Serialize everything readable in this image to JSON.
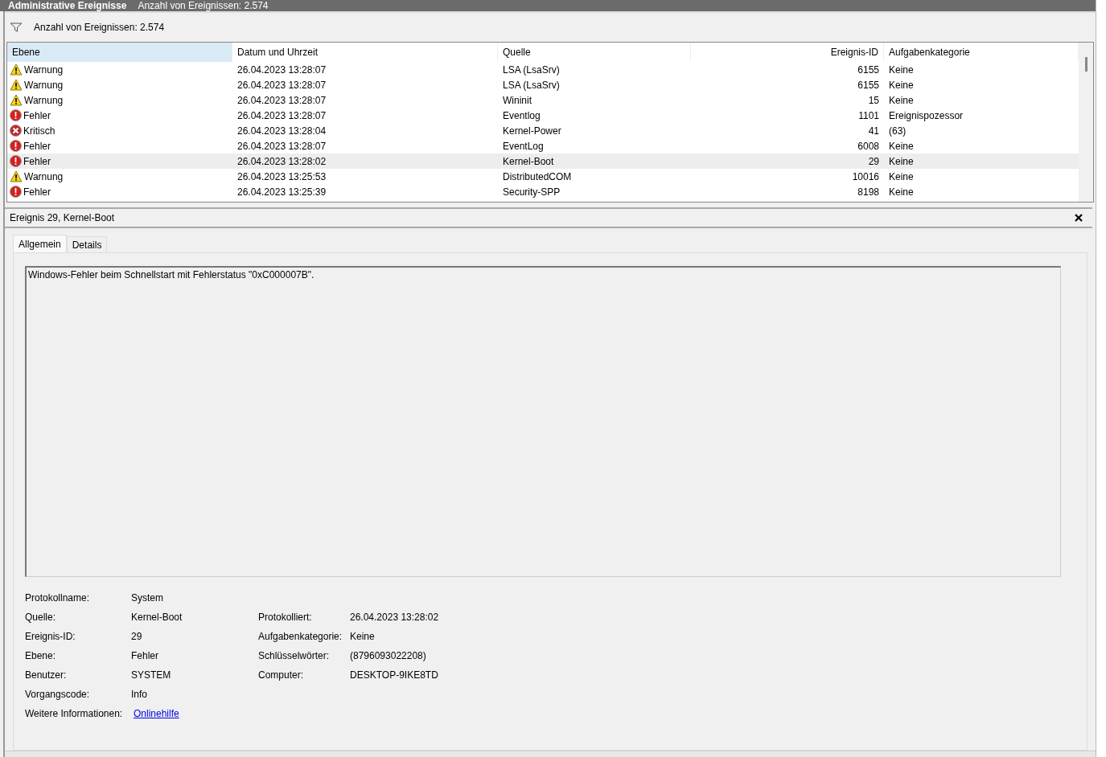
{
  "title_bar": {
    "title": "Administrative Ereignisse",
    "count": "Anzahl von Ereignissen: 2.574"
  },
  "filter_bar": {
    "text": "Anzahl von Ereignissen: 2.574"
  },
  "table": {
    "columns": [
      {
        "label": "Ebene",
        "selected": true
      },
      {
        "label": "Datum und Uhrzeit",
        "selected": false
      },
      {
        "label": "Quelle",
        "selected": false
      },
      {
        "label": "Ereignis-ID",
        "selected": false
      },
      {
        "label": "Aufgabenkategorie",
        "selected": false
      }
    ],
    "rows": [
      {
        "kind": "warning",
        "level_text": "Warnung",
        "date": "26.04.2023 13:28:07",
        "source": "LSA (LsaSrv)",
        "id": "6155",
        "category": "Keine",
        "selected": false
      },
      {
        "kind": "warning",
        "level_text": "Warnung",
        "date": "26.04.2023 13:28:07",
        "source": "LSA (LsaSrv)",
        "id": "6155",
        "category": "Keine",
        "selected": false
      },
      {
        "kind": "warning",
        "level_text": "Warnung",
        "date": "26.04.2023 13:28:07",
        "source": "Wininit",
        "id": "15",
        "category": "Keine",
        "selected": false
      },
      {
        "kind": "error",
        "level_text": "Fehler",
        "date": "26.04.2023 13:28:07",
        "source": "Eventlog",
        "id": "1101",
        "category": "Ereignispozessor",
        "selected": false
      },
      {
        "kind": "critical",
        "level_text": "Kritisch",
        "date": "26.04.2023 13:28:04",
        "source": "Kernel-Power",
        "id": "41",
        "category": "(63)",
        "selected": false
      },
      {
        "kind": "error",
        "level_text": "Fehler",
        "date": "26.04.2023 13:28:07",
        "source": "EventLog",
        "id": "6008",
        "category": "Keine",
        "selected": false
      },
      {
        "kind": "error",
        "level_text": "Fehler",
        "date": "26.04.2023 13:28:02",
        "source": "Kernel-Boot",
        "id": "29",
        "category": "Keine",
        "selected": true
      },
      {
        "kind": "warning",
        "level_text": "Warnung",
        "date": "26.04.2023 13:25:53",
        "source": "DistributedCOM",
        "id": "10016",
        "category": "Keine",
        "selected": false
      },
      {
        "kind": "error",
        "level_text": "Fehler",
        "date": "26.04.2023 13:25:39",
        "source": "Security-SPP",
        "id": "8198",
        "category": "Keine",
        "selected": false
      }
    ]
  },
  "detail": {
    "title": "Ereignis 29, Kernel-Boot",
    "tabs": [
      {
        "label": "Allgemein",
        "selected": true
      },
      {
        "label": "Details",
        "selected": false
      }
    ],
    "description": "Windows-Fehler beim Schnellstart mit Fehlerstatus \"0xC000007B\".",
    "fields_left": [
      {
        "label": "Protokollname:",
        "value": "System"
      },
      {
        "label": "Quelle:",
        "value": "Kernel-Boot"
      },
      {
        "label": "Ereignis-ID:",
        "value": "29"
      },
      {
        "label": "Ebene:",
        "value": "Fehler"
      },
      {
        "label": "Benutzer:",
        "value": "SYSTEM"
      },
      {
        "label": "Vorgangscode:",
        "value": "Info"
      },
      {
        "label": "Weitere Informationen:",
        "value": "Onlinehilfe",
        "kind": "link"
      }
    ],
    "fields_right": [
      {
        "label": "Protokolliert:",
        "value": "26.04.2023 13:28:02"
      },
      {
        "label": "Aufgabenkategorie:",
        "value": "Keine"
      },
      {
        "label": "Schlüsselwörter:",
        "value": "(8796093022208)"
      },
      {
        "label": "Computer:",
        "value": "DESKTOP-9IKE8TD"
      }
    ]
  }
}
